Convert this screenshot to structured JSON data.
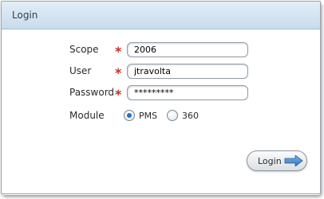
{
  "window": {
    "title": "Login"
  },
  "form": {
    "scope": {
      "label": "Scope",
      "value": "2006",
      "required": true
    },
    "user": {
      "label": "User",
      "value": "jtravolta",
      "required": true
    },
    "password": {
      "label": "Password",
      "value": "*********",
      "required": true
    },
    "module": {
      "label": "Module",
      "options": [
        {
          "label": "PMS",
          "selected": true
        },
        {
          "label": "360",
          "selected": false
        }
      ]
    },
    "required_marker": "*"
  },
  "actions": {
    "login_label": "Login",
    "login_icon": "arrow-right-icon"
  },
  "colors": {
    "title_bar": "#d3e2f0",
    "required": "#cc2a2a",
    "radio_selected": "#2a6fc2",
    "arrow": "#3f86cf"
  }
}
